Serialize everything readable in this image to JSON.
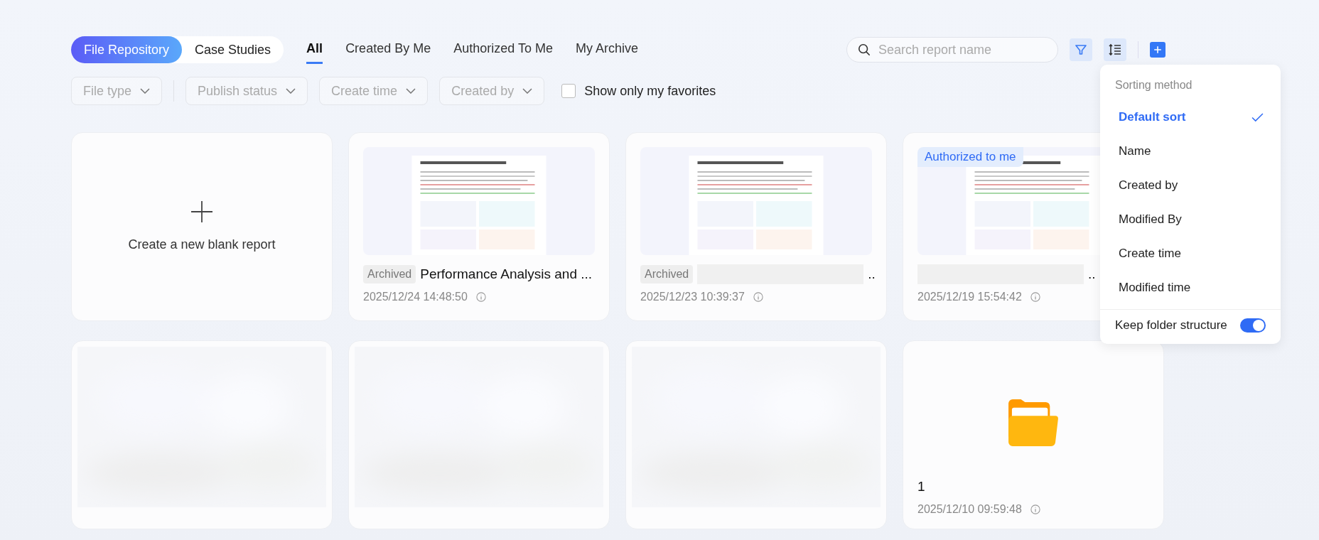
{
  "mode_switch": [
    {
      "label": "File Repository",
      "selected": true
    },
    {
      "label": "Case Studies",
      "selected": false
    }
  ],
  "tabs": [
    {
      "label": "All",
      "selected": true
    },
    {
      "label": "Created By Me",
      "selected": false
    },
    {
      "label": "Authorized To Me",
      "selected": false
    },
    {
      "label": "My Archive",
      "selected": false
    }
  ],
  "search": {
    "placeholder": "Search report name"
  },
  "filters": [
    {
      "label": "File type"
    },
    {
      "label": "Publish status"
    },
    {
      "label": "Create time"
    },
    {
      "label": "Created by"
    }
  ],
  "favorites": {
    "label": "Show only my favorites",
    "checked": false
  },
  "cards": [
    {
      "kind": "create",
      "label": "Create a new blank report"
    },
    {
      "kind": "report",
      "badge": "Archived",
      "title": "Performance Analysis and ...",
      "redacted": false,
      "time": "2025/12/24 14:48:50"
    },
    {
      "kind": "report",
      "badge": "Archived",
      "title": "..",
      "redacted": true,
      "time": "2025/12/23 10:39:37"
    },
    {
      "kind": "report",
      "tag": "Authorized to me",
      "title": "..",
      "redacted": true,
      "time": "2025/12/19 15:54:42"
    },
    {
      "kind": "blurred"
    },
    {
      "kind": "blurred"
    },
    {
      "kind": "blurred"
    },
    {
      "kind": "folder",
      "title": "1",
      "time": "2025/12/10 09:59:48"
    }
  ],
  "sort_menu": {
    "title": "Sorting method",
    "options": [
      {
        "label": "Default sort",
        "selected": true
      },
      {
        "label": "Name",
        "selected": false
      },
      {
        "label": "Created by",
        "selected": false
      },
      {
        "label": "Modified By",
        "selected": false
      },
      {
        "label": "Create time",
        "selected": false
      },
      {
        "label": "Modified time",
        "selected": false
      }
    ],
    "keep_folder": {
      "label": "Keep folder structure",
      "on": true
    }
  }
}
